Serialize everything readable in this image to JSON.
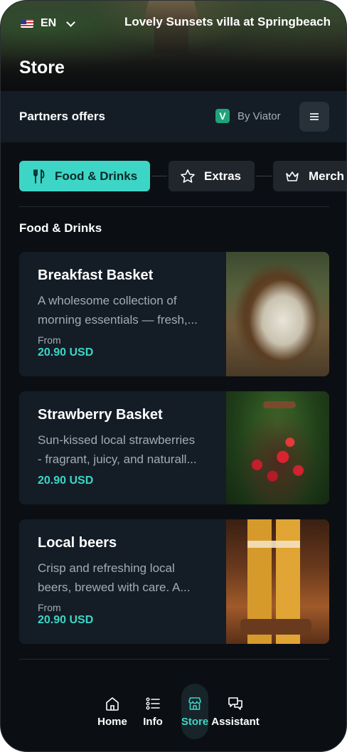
{
  "header": {
    "language": "EN",
    "villa_title": "Lovely Sunsets villa at Springbeach",
    "page_title": "Store"
  },
  "partners": {
    "label": "Partners offers",
    "provider_icon": "V",
    "provider": "By Viator"
  },
  "tabs": [
    {
      "label": "Food & Drinks",
      "icon": "utensils-icon",
      "active": true
    },
    {
      "label": "Extras",
      "icon": "star-icon",
      "active": false
    },
    {
      "label": "Merch",
      "icon": "crown-icon",
      "active": false
    }
  ],
  "section": {
    "title": "Food & Drinks"
  },
  "products": [
    {
      "title": "Breakfast Basket",
      "desc_line1": "A wholesome collection of",
      "desc_line2": "morning essentials — fresh,...",
      "from": "From",
      "price": "20.90 USD"
    },
    {
      "title": "Strawberry Basket",
      "desc_line1": "Sun-kissed local strawberries",
      "desc_line2": "- fragrant, juicy, and naturall...",
      "from": "",
      "price": "20.90 USD"
    },
    {
      "title": "Local beers",
      "desc_line1": "Crisp and refreshing local",
      "desc_line2": "beers, brewed with care. A...",
      "from": "From",
      "price": "20.90 USD"
    }
  ],
  "nav": [
    {
      "label": "Home",
      "icon": "home-icon"
    },
    {
      "label": "Info",
      "icon": "list-icon"
    },
    {
      "label": "Store",
      "icon": "store-icon",
      "active": true
    },
    {
      "label": "Assistant",
      "icon": "chat-icon"
    }
  ],
  "colors": {
    "accent": "#3dd6c6",
    "background": "#0b0f13",
    "card": "#141d26",
    "viator": "#1fa37a"
  }
}
